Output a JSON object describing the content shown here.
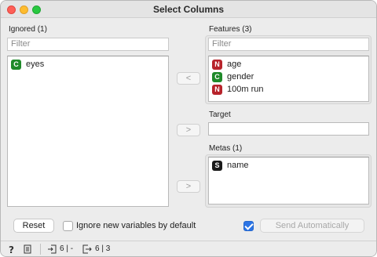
{
  "window": {
    "title": "Select Columns"
  },
  "ignored": {
    "label": "Ignored (1)",
    "filter_placeholder": "Filter",
    "items": [
      {
        "badge": "C",
        "badge_color": "#1f8a2a",
        "name": "eyes"
      }
    ]
  },
  "features": {
    "label": "Features (3)",
    "filter_placeholder": "Filter",
    "items": [
      {
        "badge": "N",
        "badge_color": "#b7232b",
        "name": "age"
      },
      {
        "badge": "C",
        "badge_color": "#1f8a2a",
        "name": "gender"
      },
      {
        "badge": "N",
        "badge_color": "#b7232b",
        "name": "100m run"
      }
    ]
  },
  "target": {
    "label": "Target"
  },
  "metas": {
    "label": "Metas (1)",
    "items": [
      {
        "badge": "S",
        "badge_color": "#1a1a1a",
        "name": "name"
      }
    ]
  },
  "arrows": {
    "to_features": "<",
    "to_target": ">",
    "to_metas": ">"
  },
  "bottom": {
    "reset_label": "Reset",
    "ignore_new_label": "Ignore new variables by default",
    "ignore_new_checked": false,
    "auto_send_checked": true,
    "send_label": "Send Automatically"
  },
  "status": {
    "help_icon": "question-icon",
    "report_icon": "document-icon",
    "input_summary": "6 | -",
    "output_summary": "6 | 3"
  }
}
